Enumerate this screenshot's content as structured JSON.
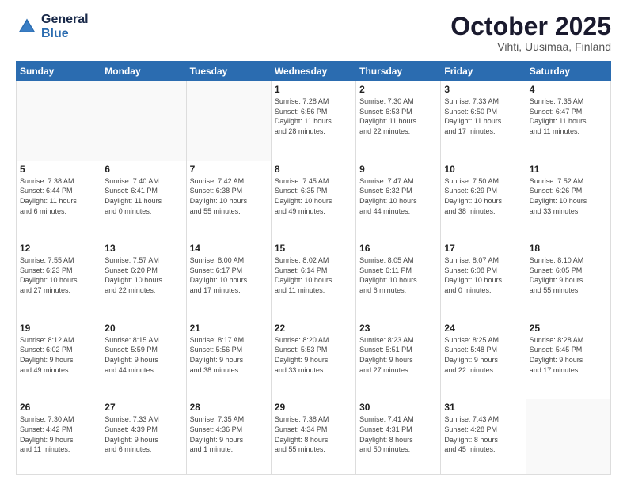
{
  "header": {
    "logo_line1": "General",
    "logo_line2": "Blue",
    "main_title": "October 2025",
    "subtitle": "Vihti, Uusimaa, Finland"
  },
  "weekdays": [
    "Sunday",
    "Monday",
    "Tuesday",
    "Wednesday",
    "Thursday",
    "Friday",
    "Saturday"
  ],
  "weeks": [
    [
      {
        "day": "",
        "info": ""
      },
      {
        "day": "",
        "info": ""
      },
      {
        "day": "",
        "info": ""
      },
      {
        "day": "1",
        "info": "Sunrise: 7:28 AM\nSunset: 6:56 PM\nDaylight: 11 hours\nand 28 minutes."
      },
      {
        "day": "2",
        "info": "Sunrise: 7:30 AM\nSunset: 6:53 PM\nDaylight: 11 hours\nand 22 minutes."
      },
      {
        "day": "3",
        "info": "Sunrise: 7:33 AM\nSunset: 6:50 PM\nDaylight: 11 hours\nand 17 minutes."
      },
      {
        "day": "4",
        "info": "Sunrise: 7:35 AM\nSunset: 6:47 PM\nDaylight: 11 hours\nand 11 minutes."
      }
    ],
    [
      {
        "day": "5",
        "info": "Sunrise: 7:38 AM\nSunset: 6:44 PM\nDaylight: 11 hours\nand 6 minutes."
      },
      {
        "day": "6",
        "info": "Sunrise: 7:40 AM\nSunset: 6:41 PM\nDaylight: 11 hours\nand 0 minutes."
      },
      {
        "day": "7",
        "info": "Sunrise: 7:42 AM\nSunset: 6:38 PM\nDaylight: 10 hours\nand 55 minutes."
      },
      {
        "day": "8",
        "info": "Sunrise: 7:45 AM\nSunset: 6:35 PM\nDaylight: 10 hours\nand 49 minutes."
      },
      {
        "day": "9",
        "info": "Sunrise: 7:47 AM\nSunset: 6:32 PM\nDaylight: 10 hours\nand 44 minutes."
      },
      {
        "day": "10",
        "info": "Sunrise: 7:50 AM\nSunset: 6:29 PM\nDaylight: 10 hours\nand 38 minutes."
      },
      {
        "day": "11",
        "info": "Sunrise: 7:52 AM\nSunset: 6:26 PM\nDaylight: 10 hours\nand 33 minutes."
      }
    ],
    [
      {
        "day": "12",
        "info": "Sunrise: 7:55 AM\nSunset: 6:23 PM\nDaylight: 10 hours\nand 27 minutes."
      },
      {
        "day": "13",
        "info": "Sunrise: 7:57 AM\nSunset: 6:20 PM\nDaylight: 10 hours\nand 22 minutes."
      },
      {
        "day": "14",
        "info": "Sunrise: 8:00 AM\nSunset: 6:17 PM\nDaylight: 10 hours\nand 17 minutes."
      },
      {
        "day": "15",
        "info": "Sunrise: 8:02 AM\nSunset: 6:14 PM\nDaylight: 10 hours\nand 11 minutes."
      },
      {
        "day": "16",
        "info": "Sunrise: 8:05 AM\nSunset: 6:11 PM\nDaylight: 10 hours\nand 6 minutes."
      },
      {
        "day": "17",
        "info": "Sunrise: 8:07 AM\nSunset: 6:08 PM\nDaylight: 10 hours\nand 0 minutes."
      },
      {
        "day": "18",
        "info": "Sunrise: 8:10 AM\nSunset: 6:05 PM\nDaylight: 9 hours\nand 55 minutes."
      }
    ],
    [
      {
        "day": "19",
        "info": "Sunrise: 8:12 AM\nSunset: 6:02 PM\nDaylight: 9 hours\nand 49 minutes."
      },
      {
        "day": "20",
        "info": "Sunrise: 8:15 AM\nSunset: 5:59 PM\nDaylight: 9 hours\nand 44 minutes."
      },
      {
        "day": "21",
        "info": "Sunrise: 8:17 AM\nSunset: 5:56 PM\nDaylight: 9 hours\nand 38 minutes."
      },
      {
        "day": "22",
        "info": "Sunrise: 8:20 AM\nSunset: 5:53 PM\nDaylight: 9 hours\nand 33 minutes."
      },
      {
        "day": "23",
        "info": "Sunrise: 8:23 AM\nSunset: 5:51 PM\nDaylight: 9 hours\nand 27 minutes."
      },
      {
        "day": "24",
        "info": "Sunrise: 8:25 AM\nSunset: 5:48 PM\nDaylight: 9 hours\nand 22 minutes."
      },
      {
        "day": "25",
        "info": "Sunrise: 8:28 AM\nSunset: 5:45 PM\nDaylight: 9 hours\nand 17 minutes."
      }
    ],
    [
      {
        "day": "26",
        "info": "Sunrise: 7:30 AM\nSunset: 4:42 PM\nDaylight: 9 hours\nand 11 minutes."
      },
      {
        "day": "27",
        "info": "Sunrise: 7:33 AM\nSunset: 4:39 PM\nDaylight: 9 hours\nand 6 minutes."
      },
      {
        "day": "28",
        "info": "Sunrise: 7:35 AM\nSunset: 4:36 PM\nDaylight: 9 hours\nand 1 minute."
      },
      {
        "day": "29",
        "info": "Sunrise: 7:38 AM\nSunset: 4:34 PM\nDaylight: 8 hours\nand 55 minutes."
      },
      {
        "day": "30",
        "info": "Sunrise: 7:41 AM\nSunset: 4:31 PM\nDaylight: 8 hours\nand 50 minutes."
      },
      {
        "day": "31",
        "info": "Sunrise: 7:43 AM\nSunset: 4:28 PM\nDaylight: 8 hours\nand 45 minutes."
      },
      {
        "day": "",
        "info": ""
      }
    ]
  ]
}
